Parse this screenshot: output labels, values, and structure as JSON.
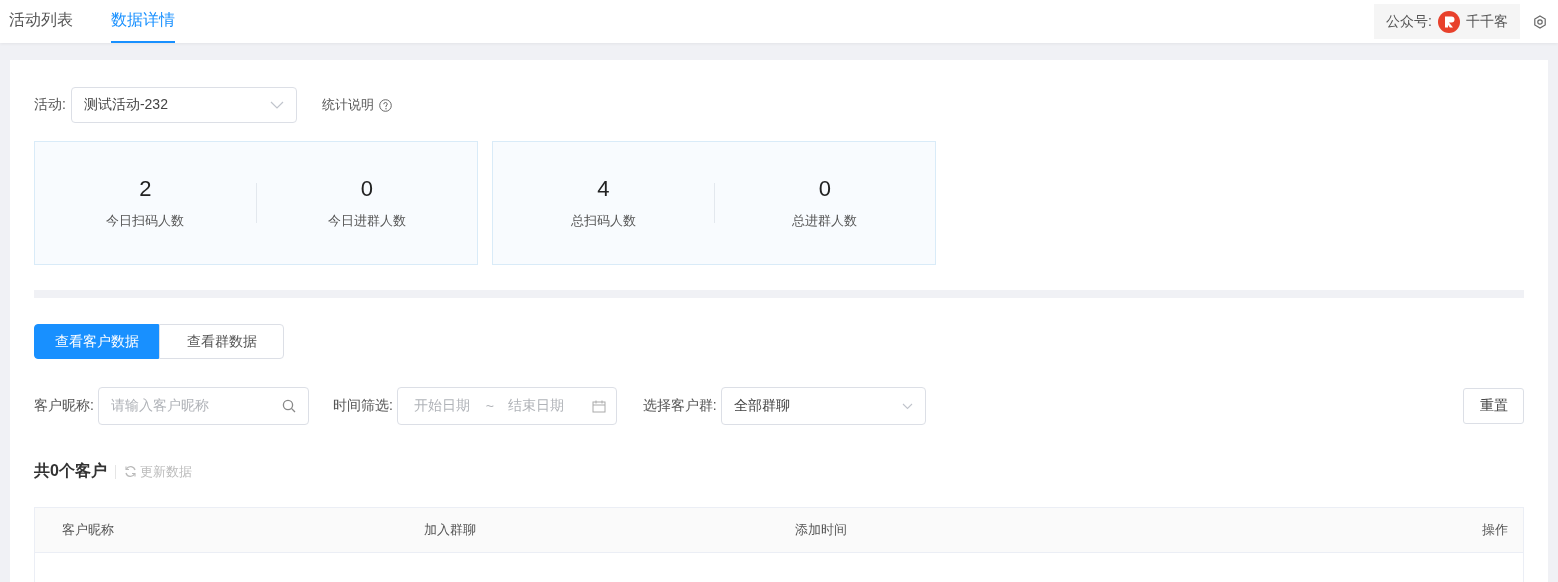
{
  "top_tabs": [
    {
      "label": "活动列表",
      "selected": false
    },
    {
      "label": "数据详情",
      "selected": true
    }
  ],
  "account": {
    "label": "公众号:",
    "name": "千千客"
  },
  "activity_filter": {
    "label": "活动:",
    "value": "测试活动-232"
  },
  "stats_help": "统计说明",
  "stat_groups": [
    {
      "items": [
        {
          "value": "2",
          "label": "今日扫码人数"
        },
        {
          "value": "0",
          "label": "今日进群人数"
        }
      ]
    },
    {
      "items": [
        {
          "value": "4",
          "label": "总扫码人数"
        },
        {
          "value": "0",
          "label": "总进群人数"
        }
      ]
    }
  ],
  "view_tabs": [
    {
      "label": "查看客户数据",
      "selected": true
    },
    {
      "label": "查看群数据",
      "selected": false
    }
  ],
  "filters": {
    "nickname_label": "客户昵称:",
    "nickname_placeholder": "请输入客户昵称",
    "time_label": "时间筛选:",
    "start_placeholder": "开始日期",
    "separator": "~",
    "end_placeholder": "结束日期",
    "group_label": "选择客户群:",
    "group_value": "全部群聊"
  },
  "reset_button": "重置",
  "summary": {
    "count": "共0个客户",
    "refresh": "更新数据"
  },
  "table": {
    "columns": [
      "客户昵称",
      "加入群聊",
      "添加时间",
      "操作"
    ]
  }
}
